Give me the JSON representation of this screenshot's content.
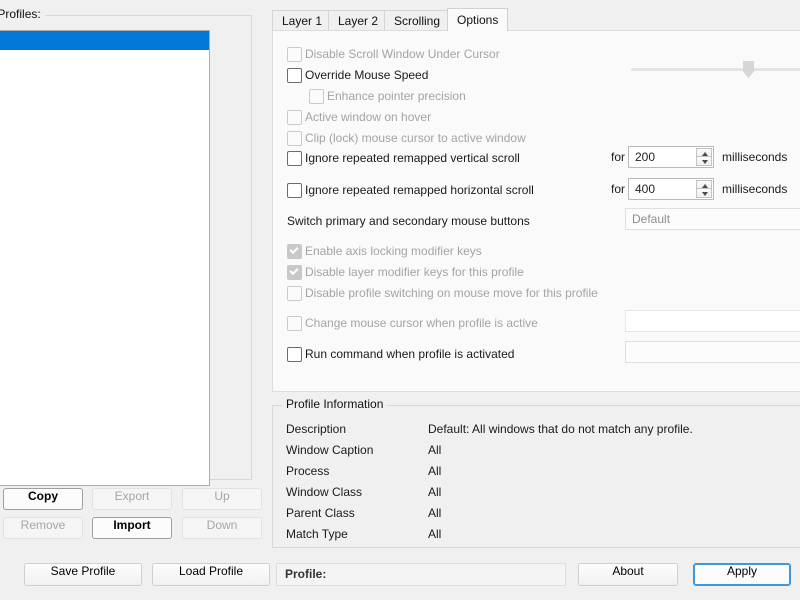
{
  "left_panel": {
    "legend": "dow Profiles:",
    "list_items": [
      {
        "label": "",
        "selected": true
      }
    ],
    "buttons": {
      "copy": "Copy",
      "export": "Export",
      "up": "Up",
      "remove": "Remove",
      "import": "Import",
      "down": "Down"
    }
  },
  "tabs": [
    {
      "label": "Layer 1",
      "active": false
    },
    {
      "label": "Layer 2",
      "active": false
    },
    {
      "label": "Scrolling",
      "active": false
    },
    {
      "label": "Options",
      "active": true
    }
  ],
  "options": {
    "disable_scroll_window_under_cursor": "Disable Scroll Window Under Cursor",
    "override_mouse_speed": "Override Mouse Speed",
    "enhance_pointer_precision": "Enhance pointer precision",
    "active_window_on_hover": "Active window on hover",
    "clip_lock_cursor": "Clip (lock) mouse cursor to active window",
    "ignore_vertical": "Ignore repeated remapped vertical scroll",
    "ignore_horizontal": "Ignore repeated remapped horizontal scroll",
    "switch_buttons": "Switch primary and secondary mouse buttons",
    "enable_axis_locking": "Enable axis locking modifier keys",
    "disable_layer_modifier": "Disable layer modifier keys for this profile",
    "disable_profile_switching": "Disable profile switching on mouse move for this profile",
    "change_mouse_cursor": "Change mouse cursor when profile is active",
    "run_command": "Run command when profile is activated",
    "for_label_1": "for",
    "for_label_2": "for",
    "unit_1": "milliseconds",
    "unit_2": "milliseconds",
    "vertical_delay_value": "200",
    "horizontal_delay_value": "400",
    "switch_buttons_value": "Default",
    "cursor_path_value": "",
    "command_value": "",
    "mouse_speed_slider_percent": 65
  },
  "profile_information": {
    "legend": "Profile Information",
    "rows": [
      {
        "key": "Description",
        "value": "Default: All windows that do not match any profile."
      },
      {
        "key": "Window Caption",
        "value": "All"
      },
      {
        "key": "Process",
        "value": "All"
      },
      {
        "key": "Window Class",
        "value": "All"
      },
      {
        "key": "Parent Class",
        "value": "All"
      },
      {
        "key": "Match Type",
        "value": "All"
      }
    ]
  },
  "bottom_bar": {
    "save_profile": "Save Profile",
    "load_profile": "Load Profile",
    "profile_field": "Profile:",
    "about": "About",
    "apply": "Apply"
  },
  "colors": {
    "selection_blue": "#0078d7",
    "focus_blue": "#3f97de",
    "window_bg": "#f0f0f0",
    "panel_bg": "#fafafa"
  }
}
